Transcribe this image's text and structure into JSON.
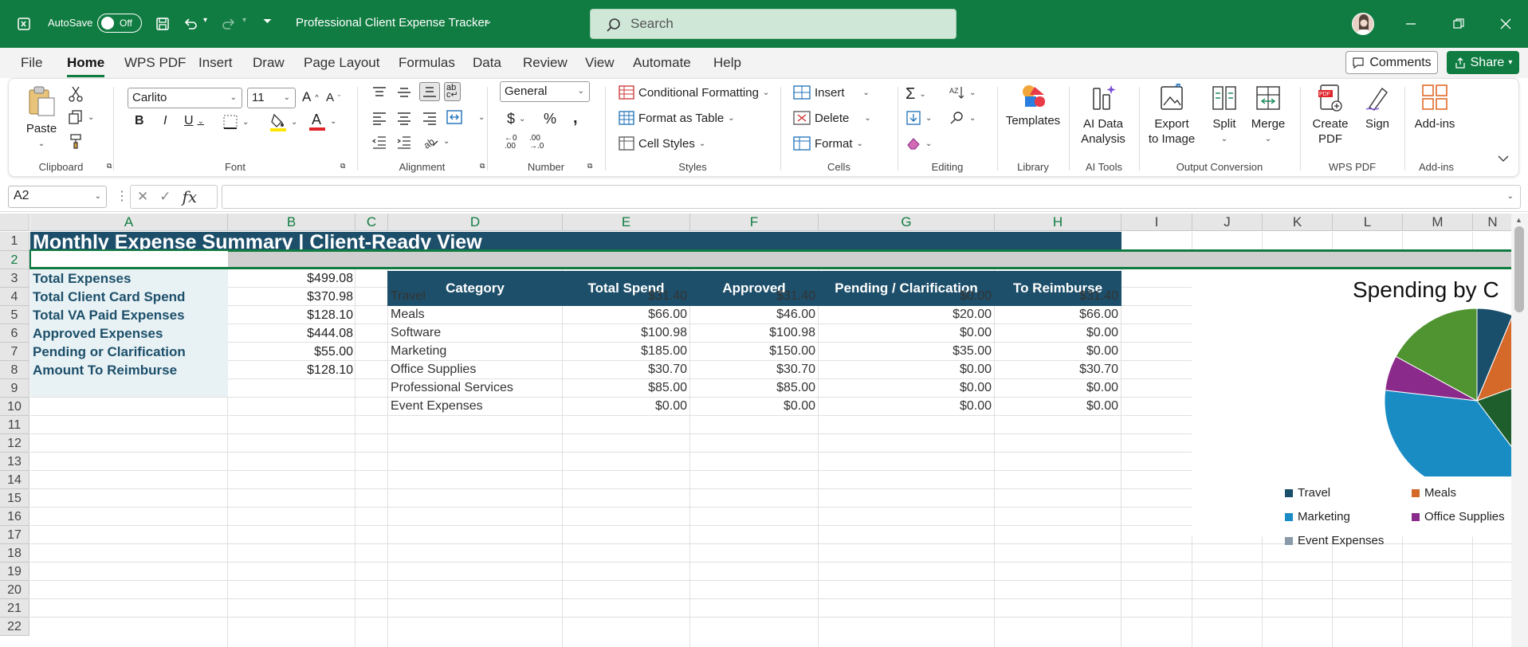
{
  "window": {
    "autosave_label": "AutoSave",
    "autosave_state": "Off",
    "doc_title": "Professional Client Expense Tracker",
    "search_placeholder": "Search"
  },
  "menu": {
    "tabs": [
      "File",
      "Home",
      "WPS PDF",
      "Insert",
      "Draw",
      "Page Layout",
      "Formulas",
      "Data",
      "Review",
      "View",
      "Automate",
      "Help"
    ],
    "active": "Home",
    "comments_label": "Comments",
    "share_label": "Share"
  },
  "ribbon": {
    "paste_label": "Paste",
    "font_name": "Carlito",
    "font_size": "11",
    "number_format": "General",
    "conditional_formatting": "Conditional Formatting",
    "format_as_table": "Format as Table",
    "cell_styles": "Cell Styles",
    "insert": "Insert",
    "delete": "Delete",
    "format": "Format",
    "templates": "Templates",
    "ai_data_analysis": [
      "AI Data",
      "Analysis"
    ],
    "export_to_image": [
      "Export",
      "to Image"
    ],
    "split": "Split",
    "merge": "Merge",
    "create_pdf": [
      "Create",
      "PDF"
    ],
    "sign": "Sign",
    "add_ins": "Add-ins",
    "groups": {
      "clipboard": "Clipboard",
      "font": "Font",
      "alignment": "Alignment",
      "number": "Number",
      "styles": "Styles",
      "cells": "Cells",
      "editing": "Editing",
      "library": "Library",
      "ai_tools": "AI Tools",
      "output_conversion": "Output Conversion",
      "wps_pdf": "WPS PDF",
      "add_ins": "Add-ins"
    }
  },
  "formula_bar": {
    "name_box": "A2",
    "fx": "fx",
    "content": ""
  },
  "sheet": {
    "columns": [
      "A",
      "B",
      "C",
      "D",
      "E",
      "F",
      "G",
      "H",
      "I",
      "J",
      "K",
      "L",
      "M",
      "N"
    ],
    "rows": [
      "1",
      "2",
      "3",
      "4",
      "5",
      "6",
      "7",
      "8",
      "9",
      "10",
      "11",
      "12",
      "13",
      "14",
      "15",
      "16",
      "17",
      "18",
      "19",
      "20",
      "21",
      "22"
    ],
    "title": "Monthly Expense Summary | Client-Ready View",
    "summary": [
      {
        "label": "Total Expenses",
        "value": "$499.08"
      },
      {
        "label": "Total Client Card Spend",
        "value": "$370.98"
      },
      {
        "label": "Total VA Paid Expenses",
        "value": "$128.10"
      },
      {
        "label": "Approved Expenses",
        "value": "$444.08"
      },
      {
        "label": "Pending or Clarification",
        "value": "$55.00"
      },
      {
        "label": "Amount To Reimburse",
        "value": "$128.10"
      }
    ],
    "table_headers": [
      "Category",
      "Total Spend",
      "Approved",
      "Pending / Clarification",
      "To Reimburse"
    ],
    "table_rows": [
      [
        "Travel",
        "$31.40",
        "$31.40",
        "$0.00",
        "$31.40"
      ],
      [
        "Meals",
        "$66.00",
        "$46.00",
        "$20.00",
        "$66.00"
      ],
      [
        "Software",
        "$100.98",
        "$100.98",
        "$0.00",
        "$0.00"
      ],
      [
        "Marketing",
        "$185.00",
        "$150.00",
        "$35.00",
        "$0.00"
      ],
      [
        "Office Supplies",
        "$30.70",
        "$30.70",
        "$0.00",
        "$30.70"
      ],
      [
        "Professional Services",
        "$85.00",
        "$85.00",
        "$0.00",
        "$0.00"
      ],
      [
        "Event Expenses",
        "$0.00",
        "$0.00",
        "$0.00",
        "$0.00"
      ]
    ]
  },
  "chart_data": {
    "type": "pie",
    "title": "Spending by C",
    "categories": [
      "Travel",
      "Meals",
      "Software",
      "Marketing",
      "Office Supplies",
      "Professional Services",
      "Event Expenses"
    ],
    "values": [
      31.4,
      66.0,
      100.98,
      185.0,
      30.7,
      85.0,
      0.0
    ],
    "colors": [
      "#1a4f6b",
      "#d4692a",
      "#1e5e2d",
      "#1a8cc4",
      "#8a2a8a",
      "#4f9430",
      "#8a9aa8"
    ],
    "legend": [
      "Travel",
      "Meals",
      "Marketing",
      "Office Supplies",
      "Event Expenses"
    ],
    "legend_position": "bottom"
  },
  "colors": {
    "excel_green": "#107C41",
    "table_header": "#1d4f6a",
    "summary_fill": "#e8f2f5"
  }
}
